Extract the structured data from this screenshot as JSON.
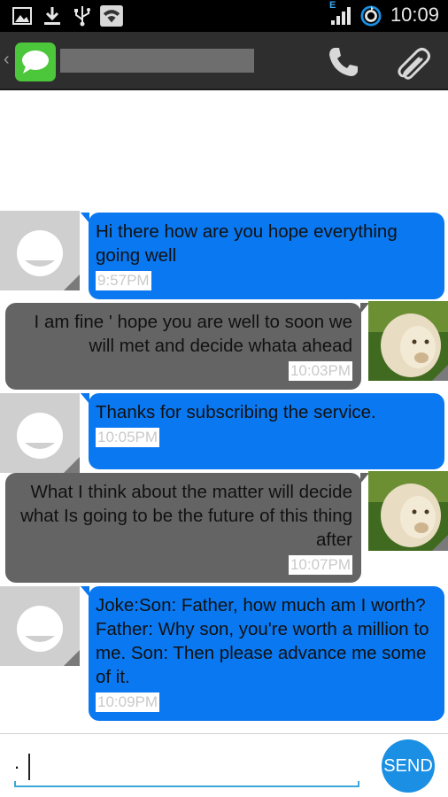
{
  "status_bar": {
    "time": "10:09",
    "network_type": "E",
    "icons": [
      "picture-icon",
      "download-icon",
      "usb-icon",
      "wifi-icon",
      "signal-icon",
      "sync-icon"
    ]
  },
  "action_bar": {
    "icons": [
      "back-chevron-icon",
      "messaging-app-icon",
      "phone-icon",
      "paperclip-icon"
    ],
    "back_glyph": "‹"
  },
  "colors": {
    "outgoing_bubble": "#0a78f0",
    "incoming_bubble": "#646464",
    "send_button": "#1a8fe3",
    "app_icon": "#4cc63a",
    "action_bar": "#2e2e2e"
  },
  "messages": [
    {
      "direction": "sent",
      "text": "Hi there how are you hope everything going well",
      "time": "9:57PM"
    },
    {
      "direction": "received",
      "text": "I am fine ' hope you are well to soon we will met and decide whata ahead",
      "time": "10:03PM"
    },
    {
      "direction": "sent",
      "text": "Thanks for subscribing the service.",
      "time": "10:05PM"
    },
    {
      "direction": "received",
      "text": "What I think about the matter will decide what Is going to be the future of this thing after",
      "time": "10:07PM"
    },
    {
      "direction": "sent",
      "text": "Joke:Son: Father, how much am I worth? Father: Why son, you're worth a million to me. Son: Then please advance me some of it.",
      "time": "10:09PM"
    }
  ],
  "composer": {
    "input_value": ".",
    "send_label": "SEND"
  }
}
